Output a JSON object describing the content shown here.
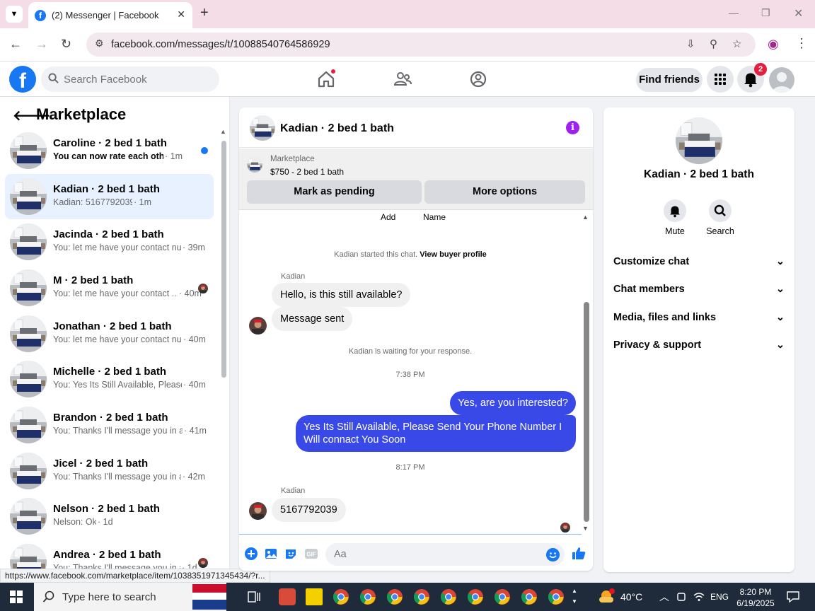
{
  "browser": {
    "tab_title": "(2) Messenger | Facebook",
    "url": "facebook.com/messages/t/10088540764586929",
    "status_url": "https://www.facebook.com/marketplace/item/1038351971345434/?r..."
  },
  "fb_header": {
    "search_placeholder": "Search Facebook",
    "find_friends": "Find friends",
    "notification_count": "2"
  },
  "sidebar": {
    "title": "Marketplace",
    "conversations": [
      {
        "name": "Caroline · 2 bed 1 bath",
        "preview": "You can now rate each other",
        "time": "· 1m",
        "unread": true
      },
      {
        "name": "Kadian · 2 bed 1 bath",
        "preview": "Kadian: 5167792039",
        "time": "· 1m",
        "active": true
      },
      {
        "name": "Jacinda · 2 bed 1 bath",
        "preview": "You: let me have your contact nu...",
        "time": "· 39m"
      },
      {
        "name": "M · 2 bed 1 bath",
        "preview": "You: let me have your contact ...",
        "time": "· 40m"
      },
      {
        "name": "Jonathan · 2 bed 1 bath",
        "preview": "You: let me have your contact nu...",
        "time": "· 40m"
      },
      {
        "name": "Michelle · 2 bed 1 bath",
        "preview": "You: Yes Its Still Available, Please ...",
        "time": "· 40m"
      },
      {
        "name": "Brandon · 2 bed 1 bath",
        "preview": "You: Thanks I'll message you in a ...",
        "time": "· 41m"
      },
      {
        "name": "Jicel · 2 bed 1 bath",
        "preview": "You: Thanks I'll message you in a ...",
        "time": "· 42m"
      },
      {
        "name": "Nelson · 2 bed 1 bath",
        "preview": "Nelson: Ok",
        "time": "· 1d"
      },
      {
        "name": "Andrea · 2 bed 1 bath",
        "preview": "You: Thanks I'll message you in a ...",
        "time": "· 1d"
      }
    ]
  },
  "chat": {
    "title": "Kadian · 2 bed 1 bath",
    "listing_label": "Marketplace",
    "listing_price": "$750 - 2 bed 1 bath",
    "mark_pending": "Mark as pending",
    "more_options": "More options",
    "partial_add": "Add",
    "partial_name": "Name",
    "started_text": "Kadian started this chat.",
    "view_profile": "View buyer profile",
    "sender_name": "Kadian",
    "msg1": "Hello, is this still available?",
    "msg2": "Message sent",
    "waiting": "Kadian is waiting for your response.",
    "time1": "7:38 PM",
    "out1": "Yes, are you interested?",
    "out2": "Yes Its Still Available, Please Send Your Phone Number I Will connact You Soon",
    "time2": "8:17 PM",
    "msg3": "5167792039",
    "input_placeholder": "Aa"
  },
  "info_panel": {
    "name": "Kadian · 2 bed 1 bath",
    "mute": "Mute",
    "search": "Search",
    "sections": [
      "Customize chat",
      "Chat members",
      "Media, files and links",
      "Privacy & support"
    ]
  },
  "taskbar": {
    "search_placeholder": "Type here to search",
    "temperature": "40°C",
    "language": "ENG",
    "time": "8:20 PM",
    "date": "6/19/2025"
  },
  "colors": {
    "fb_blue": "#1877f2",
    "outgoing_bubble": "#3949e8",
    "active_row": "#e7f1ff"
  }
}
